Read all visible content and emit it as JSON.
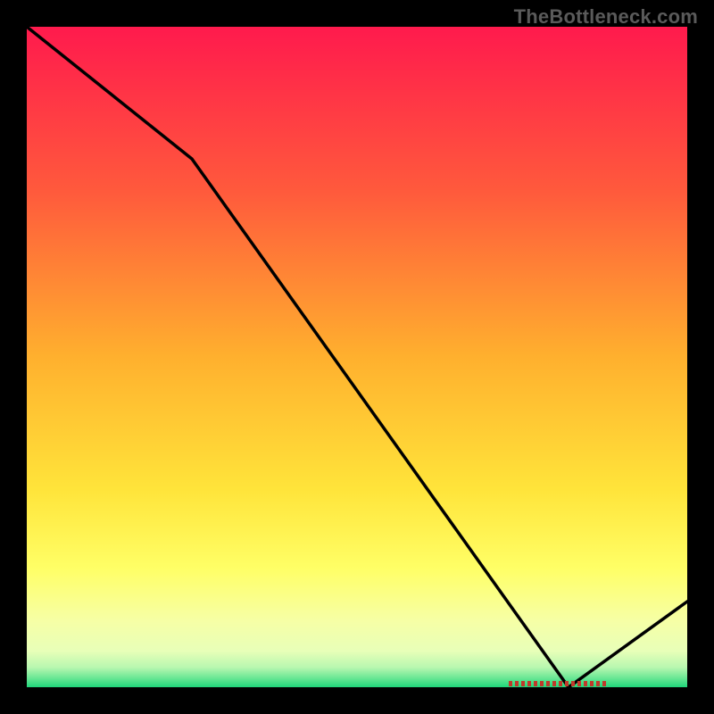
{
  "watermark": "TheBottleneck.com",
  "chart_data": {
    "type": "line",
    "title": "",
    "xlabel": "",
    "ylabel": "",
    "x": [
      0.0,
      0.25,
      0.82,
      1.0
    ],
    "values": [
      1.0,
      0.8,
      0.0,
      0.13
    ],
    "xlim": [
      0,
      1
    ],
    "ylim": [
      0,
      1
    ],
    "marker": {
      "x_start": 0.73,
      "x_end": 0.88,
      "y": 0.0,
      "label": ""
    },
    "background": {
      "type": "vertical-gradient",
      "stops": [
        {
          "pos": 0.0,
          "color": "#ff1a4d"
        },
        {
          "pos": 0.25,
          "color": "#ff5a3c"
        },
        {
          "pos": 0.5,
          "color": "#ffb02e"
        },
        {
          "pos": 0.7,
          "color": "#ffe43a"
        },
        {
          "pos": 0.82,
          "color": "#ffff66"
        },
        {
          "pos": 0.9,
          "color": "#f6ffa6"
        },
        {
          "pos": 0.945,
          "color": "#e8ffb8"
        },
        {
          "pos": 0.97,
          "color": "#b8f7b0"
        },
        {
          "pos": 0.985,
          "color": "#6fe896"
        },
        {
          "pos": 1.0,
          "color": "#1fd67a"
        }
      ]
    }
  }
}
